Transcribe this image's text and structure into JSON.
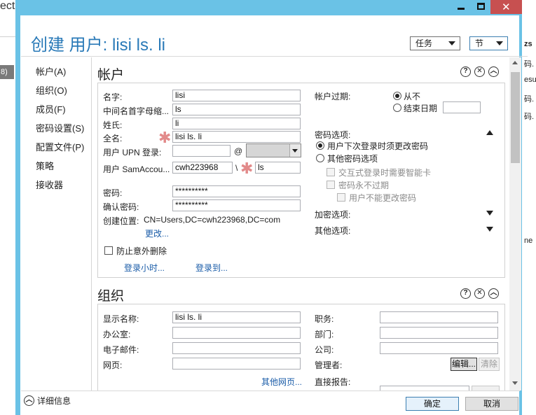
{
  "background": {
    "left_title": "ecto",
    "left_selected": "8)",
    "right_items": [
      "zs",
      "码.",
      "esu",
      "码.",
      "码.",
      "码.",
      "码.",
      "码.",
      "码.",
      "ne"
    ],
    "right_items_visible": [
      "zs",
      "码.",
      "esu",
      "码.",
      "码.",
      "ne"
    ]
  },
  "window": {
    "title": "创建 用户: lisi ls. li",
    "tasks_dropdown": "任务",
    "section_dropdown": "节",
    "accent_color": "#6ac2e6",
    "title_color": "#2a7ab8"
  },
  "nav": {
    "items": [
      "帐户(A)",
      "组织(O)",
      "成员(F)",
      "密码设置(S)",
      "配置文件(P)",
      "策略",
      "接收器"
    ]
  },
  "account": {
    "heading": "帐户",
    "first_name_label": "名字:",
    "first_name_value": "lisi",
    "initials_label": "中间名首字母缩...",
    "initials_value": "ls",
    "last_name_label": "姓氏:",
    "last_name_value": "li",
    "full_name_label": "全名:",
    "full_name_value": "lisi ls. li",
    "upn_label": "用户 UPN 登录:",
    "upn_value": "",
    "upn_at": "@",
    "upn_domain": "",
    "sam_label": "用户 SamAccou...",
    "sam_domain": "cwh223968",
    "sam_sep": "\\",
    "sam_value": "ls",
    "password_label": "密码:",
    "password_value": "**********",
    "confirm_label": "确认密码:",
    "confirm_value": "**********",
    "create_in_label": "创建位置:",
    "create_in_value": "CN=Users,DC=cwh223968,DC=com",
    "change_link": "更改...",
    "protect_label": "防止意外删除",
    "logon_hours_link": "登录小时...",
    "logon_to_link": "登录到...",
    "expires_label": "帐户过期:",
    "never_label": "从不",
    "end_date_label": "结束日期",
    "end_date_value": "",
    "pwd_options_label": "密码选项:",
    "must_change_label": "用户下次登录时须更改密码",
    "other_options_label": "其他密码选项",
    "smartcard_label": "交互式登录时需要智能卡",
    "never_expires_label": "密码永不过期",
    "cannot_change_label": "用户不能更改密码",
    "encryption_label": "加密选项:",
    "other_label": "其他选项:"
  },
  "organization": {
    "heading": "组织",
    "display_name_label": "显示名称:",
    "display_name_value": "lisi ls. li",
    "office_label": "办公室:",
    "office_value": "",
    "email_label": "电子邮件:",
    "email_value": "",
    "web_label": "网页:",
    "web_value": "",
    "more_web_link": "其他网页...",
    "job_title_label": "职务:",
    "job_title_value": "",
    "department_label": "部门:",
    "department_value": "",
    "company_label": "公司:",
    "company_value": "",
    "manager_label": "管理者:",
    "edit_button": "编辑...",
    "clear_button": "清除",
    "direct_reports_label": "直接报告:"
  },
  "footer": {
    "details_label": "详细信息",
    "ok_button": "确定",
    "cancel_button": "取消"
  },
  "icons": [
    "minimize-icon",
    "maximize-icon",
    "close-icon",
    "help-icon",
    "section-close-icon",
    "collapse-icon",
    "chevron-down-icon",
    "scroll-up-icon",
    "scroll-down-icon",
    "expand-details-icon"
  ]
}
